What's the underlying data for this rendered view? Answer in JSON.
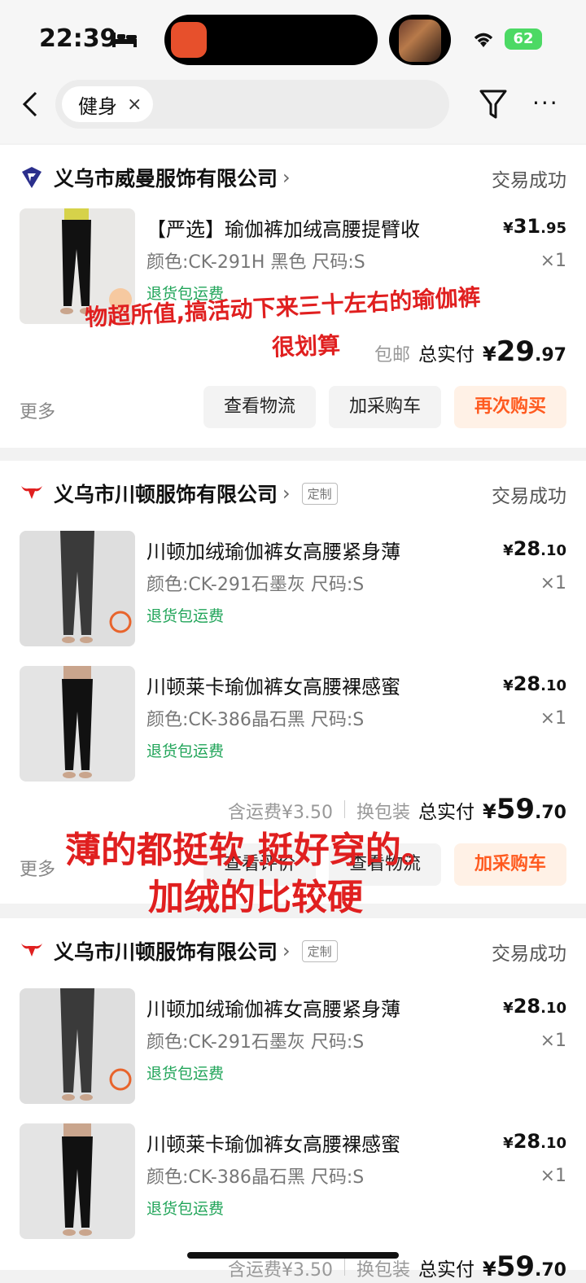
{
  "status_bar": {
    "time": "22:39",
    "battery": "62"
  },
  "search": {
    "chip_text": "健身",
    "chip_close": "×",
    "more_glyph": "···"
  },
  "orders": [
    {
      "shop": "义乌市威曼服饰有限公司",
      "status": "交易成功",
      "items": [
        {
          "title": "【严选】瑜伽裤加绒高腰提臂收",
          "spec": "颜色:CK-291H 黑色 尺码:S",
          "ship": "退货包运费",
          "price_yen": "¥",
          "price_int": "31",
          "price_dec": ".95",
          "qty": "×1"
        }
      ],
      "summary": {
        "note": "包邮",
        "label": "总实付",
        "yen": "¥",
        "int": "29",
        "dec": ".97"
      },
      "more": "更多",
      "buttons": [
        "查看物流",
        "加采购车",
        "再次购买"
      ],
      "handwritten": [
        "物超所值,搞活动下来三十左右的瑜伽裤",
        "很划算"
      ]
    },
    {
      "shop": "义乌市川顿服饰有限公司",
      "tag": "定制",
      "status": "交易成功",
      "items": [
        {
          "title": "川顿加绒瑜伽裤女高腰紧身薄",
          "spec": "颜色:CK-291石墨灰 尺码:S",
          "ship": "退货包运费",
          "price_yen": "¥",
          "price_int": "28",
          "price_dec": ".10",
          "qty": "×1"
        },
        {
          "title": "川顿莱卡瑜伽裤女高腰裸感蜜",
          "spec": "颜色:CK-386晶石黑 尺码:S",
          "ship": "退货包运费",
          "price_yen": "¥",
          "price_int": "28",
          "price_dec": ".10",
          "qty": "×1"
        }
      ],
      "summary": {
        "note": "含运费¥3.50",
        "note2": "换包装",
        "label": "总实付",
        "yen": "¥",
        "int": "59",
        "dec": ".70"
      },
      "more": "更多",
      "buttons": [
        "查看评价",
        "查看物流",
        "加采购车"
      ],
      "handwritten": [
        "薄的都挺软,挺好穿的。",
        "加绒的比较硬"
      ]
    },
    {
      "shop": "义乌市川顿服饰有限公司",
      "tag": "定制",
      "status": "交易成功",
      "items": [
        {
          "title": "川顿加绒瑜伽裤女高腰紧身薄",
          "spec": "颜色:CK-291石墨灰 尺码:S",
          "ship": "退货包运费",
          "price_yen": "¥",
          "price_int": "28",
          "price_dec": ".10",
          "qty": "×1"
        },
        {
          "title": "川顿莱卡瑜伽裤女高腰裸感蜜",
          "spec": "颜色:CK-386晶石黑 尺码:S",
          "ship": "退货包运费",
          "price_yen": "¥",
          "price_int": "28",
          "price_dec": ".10",
          "qty": "×1"
        }
      ],
      "summary": {
        "note": "含运费¥3.50",
        "note2": "换包装",
        "label": "总实付",
        "yen": "¥",
        "int": "59",
        "dec": ".70"
      }
    }
  ],
  "colors": {
    "orange": "#ff5a1f",
    "green": "#22a55a",
    "annotation_red": "#e01f1f"
  }
}
